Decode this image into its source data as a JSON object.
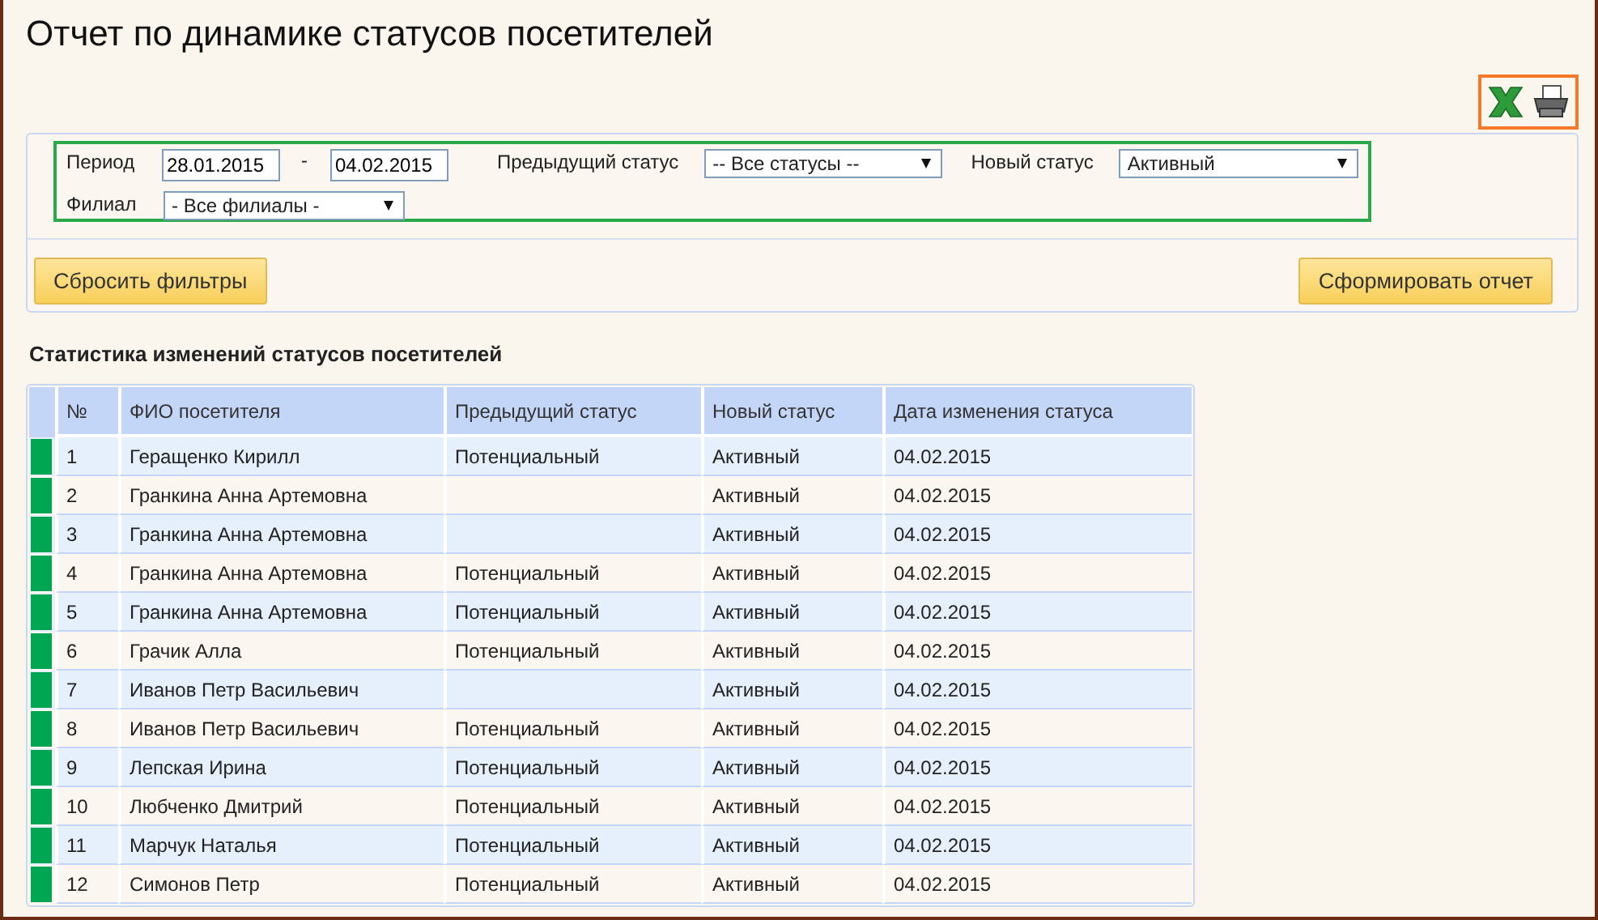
{
  "title": "Отчет по динамике статусов посетителей",
  "filters": {
    "period_label": "Период",
    "date_from": "28.01.2015",
    "dash": "-",
    "date_to": "04.02.2015",
    "prev_status_label": "Предыдущий статус",
    "prev_status": "-- Все статусы --",
    "new_status_label": "Новый статус",
    "new_status": "Активный",
    "branch_label": "Филиал",
    "branch": "- Все филиалы -"
  },
  "buttons": {
    "reset": "Сбросить фильтры",
    "generate": "Сформировать отчет"
  },
  "section_title": "Статистика изменений статусов посетителей",
  "table": {
    "columns": [
      "№",
      "ФИО посетителя",
      "Предыдущий статус",
      "Новый статус",
      "Дата изменения статуса"
    ],
    "rows": [
      {
        "color": "#00a651",
        "cells": [
          "1",
          "Геращенко Кирилл",
          "Потенциальный",
          "Активный",
          "04.02.2015"
        ]
      },
      {
        "color": "#00a651",
        "cells": [
          "2",
          "Гранкина Анна Артемовна",
          "",
          "Активный",
          "04.02.2015"
        ]
      },
      {
        "color": "#00a651",
        "cells": [
          "3",
          "Гранкина Анна Артемовна",
          "",
          "Активный",
          "04.02.2015"
        ]
      },
      {
        "color": "#00a651",
        "cells": [
          "4",
          "Гранкина Анна Артемовна",
          "Потенциальный",
          "Активный",
          "04.02.2015"
        ]
      },
      {
        "color": "#00a651",
        "cells": [
          "5",
          "Гранкина Анна Артемовна",
          "Потенциальный",
          "Активный",
          "04.02.2015"
        ]
      },
      {
        "color": "#00a651",
        "cells": [
          "6",
          "Грачик Алла",
          "Потенциальный",
          "Активный",
          "04.02.2015"
        ]
      },
      {
        "color": "#00a651",
        "cells": [
          "7",
          "Иванов Петр Васильевич",
          "",
          "Активный",
          "04.02.2015"
        ]
      },
      {
        "color": "#00a651",
        "cells": [
          "8",
          "Иванов Петр Васильевич",
          "Потенциальный",
          "Активный",
          "04.02.2015"
        ]
      },
      {
        "color": "#00a651",
        "cells": [
          "9",
          "Лепская Ирина",
          "Потенциальный",
          "Активный",
          "04.02.2015"
        ]
      },
      {
        "color": "#00a651",
        "cells": [
          "10",
          "Любченко Дмитрий",
          "Потенциальный",
          "Активный",
          "04.02.2015"
        ]
      },
      {
        "color": "#00a651",
        "cells": [
          "11",
          "Марчук Наталья",
          "Потенциальный",
          "Активный",
          "04.02.2015"
        ]
      },
      {
        "color": "#00a651",
        "cells": [
          "12",
          "Симонов Петр",
          "Потенциальный",
          "Активный",
          "04.02.2015"
        ]
      }
    ]
  }
}
